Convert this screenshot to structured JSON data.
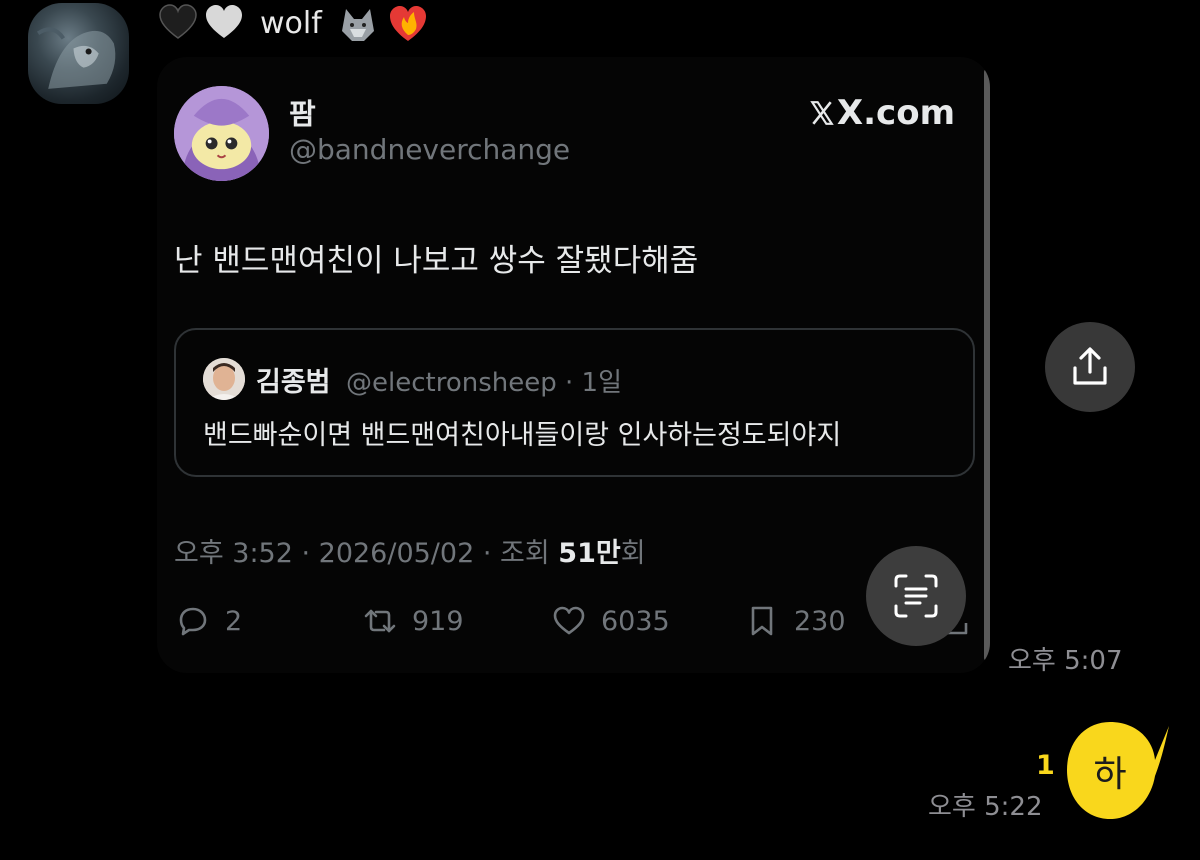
{
  "sender": {
    "name": "wolf",
    "name_emojis": [
      "black-heart",
      "white-heart",
      "wolf",
      "heart-on-fire"
    ]
  },
  "tweet": {
    "author_name": "팜",
    "author_handle": "@bandneverchange",
    "brand": "X.com",
    "text": "난 밴드맨여친이 나보고 쌍수 잘됐다해줌",
    "quote": {
      "author_name": "김종범",
      "author_handle_and_age": "@electronsheep · 1일",
      "text": "밴드빠순이면 밴드맨여친아내들이랑 인사하는정도되야지"
    },
    "timestamp_prefix": "오후 3:52 · 2026/05/02 · 조회 ",
    "views": "51만",
    "views_suffix": "회",
    "replies": "2",
    "retweets": "919",
    "likes": "6035",
    "bookmarks": "230"
  },
  "messages": {
    "received_time": "오후 5:07",
    "sent_text": "하",
    "sent_unread_count": "1",
    "sent_time": "오후 5:22"
  },
  "colors": {
    "background": "#000000",
    "my_bubble": "#F9D71C",
    "unread_count": "#F9D71C",
    "muted_text": "#71767B"
  }
}
